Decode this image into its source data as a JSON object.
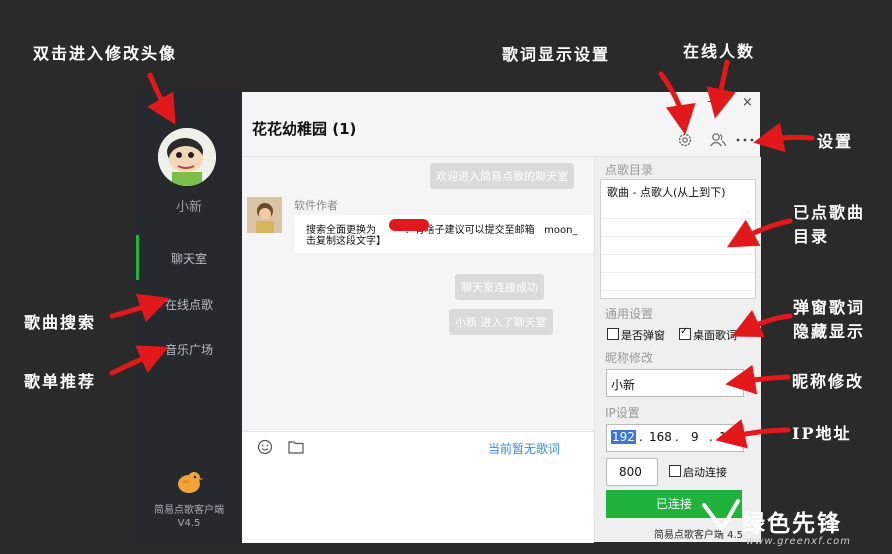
{
  "annotations": {
    "avatar_hint": "双击进入修改头像",
    "lyric_display_settings": "歌词显示设置",
    "online_count": "在线人数",
    "settings": "设置",
    "played_list": "已点歌曲\n目录",
    "popup_lyrics": "弹窗歌词\n隐藏显示",
    "nickname_edit": "昵称修改",
    "ip_address": "IP地址",
    "song_search": "歌曲搜索",
    "playlist_recommend": "歌单推荐"
  },
  "sidebar": {
    "nickname": "小新",
    "items": [
      {
        "label": "聊天室",
        "active": true
      },
      {
        "label": "在线点歌",
        "active": false
      },
      {
        "label": "音乐广场",
        "active": false
      }
    ],
    "client_name": "简易点歌客户端",
    "version": "V4.5"
  },
  "window": {
    "title": "花花幼稚园 (1)",
    "minimize": "–",
    "close": "×",
    "icons": [
      "gear-icon",
      "users-icon",
      "more-icon"
    ]
  },
  "chat": {
    "welcome": "欢迎进入简易点歌的聊天室",
    "sender": "软件作者",
    "message": "搜索全面更换为         ！有啥子建议可以提交至邮箱   moon_\n击复制这段文字】",
    "connected": "聊天室连接成功",
    "joined": "小新  进入了聊天室"
  },
  "input": {
    "emoji_icon": "smile-icon",
    "folder_icon": "folder-icon",
    "lyric_status": "当前暂无歌词"
  },
  "panel": {
    "playlist_label": "点歌目录",
    "playlist_header": "歌曲 - 点歌人(从上到下)",
    "general_label": "通用设置",
    "popup_label": "是否弹窗",
    "popup_checked": false,
    "desktop_lyrics_label": "桌面歌词",
    "desktop_lyrics_checked": true,
    "nickname_label": "昵称修改",
    "nickname_value": "小新",
    "ip_label": "IP设置",
    "ip_parts": [
      "192",
      "168",
      "9",
      "1("
    ],
    "port": "800",
    "auto_connect_label": "启动连接",
    "auto_connect_checked": false,
    "connect_button": "已连接",
    "footer": "简易点歌客户端 4.5"
  },
  "watermark": {
    "text": "绿色先锋",
    "url": "www.greenxf.com"
  },
  "colors": {
    "background": "#2a2a2a",
    "sidebar": "#26292e",
    "accent_green": "#1fb33c",
    "arrow_red": "#e3181b",
    "link_blue": "#3b8bd9"
  }
}
